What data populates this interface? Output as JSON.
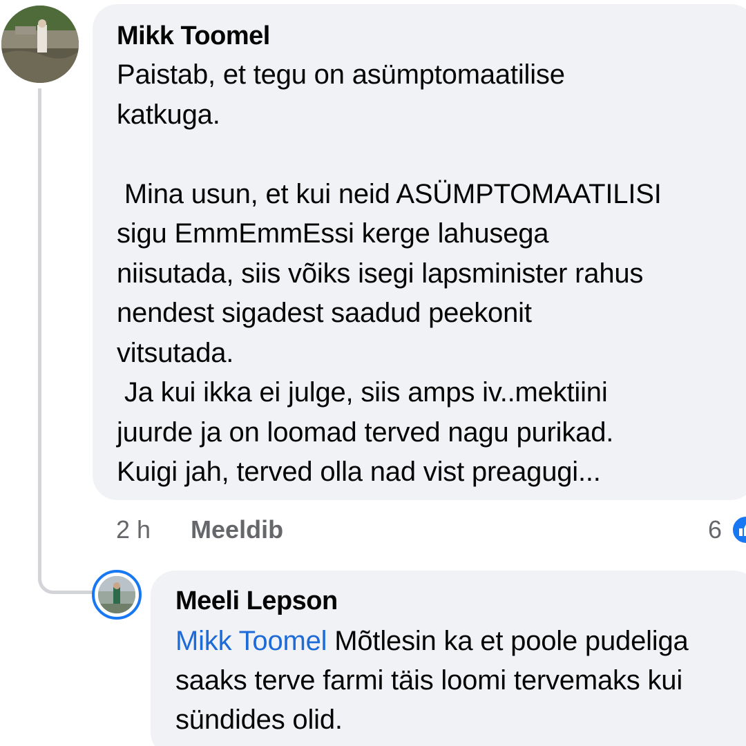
{
  "comment": {
    "author": "Mikk Toomel",
    "text": "Paistab, et tegu on asümptomaatilise\nkatkuga.\n\n Mina usun, et kui neid ASÜMPTOMAATILISI\nsigu EmmEmmEssi kerge lahusega\nniisutada, siis võiks isegi lapsminister rahus\nnendest sigadest saadud peekonit\nvitsutada.\n Ja kui ikka ei julge, siis amps iv..mektiini\njuurde ja on loomad terved nagu purikad.\nKuigi jah, terved olla nad vist preagugi...",
    "time": "2 h",
    "like_label": "Meeldib",
    "reaction_count": "6",
    "reaction_icon": "like-icon"
  },
  "reply": {
    "author": "Meeli Lepson",
    "mention": "Mikk Toomel",
    "text": " Mõtlesin ka et poole pudeliga saaks terve farmi täis loomi tervemaks kui sündides olid."
  },
  "colors": {
    "bubble": "#f0f2f5",
    "mention": "#1d6bd8",
    "meta": "#65676b",
    "accent": "#1877f2",
    "thread_line": "#d2d4d8"
  }
}
